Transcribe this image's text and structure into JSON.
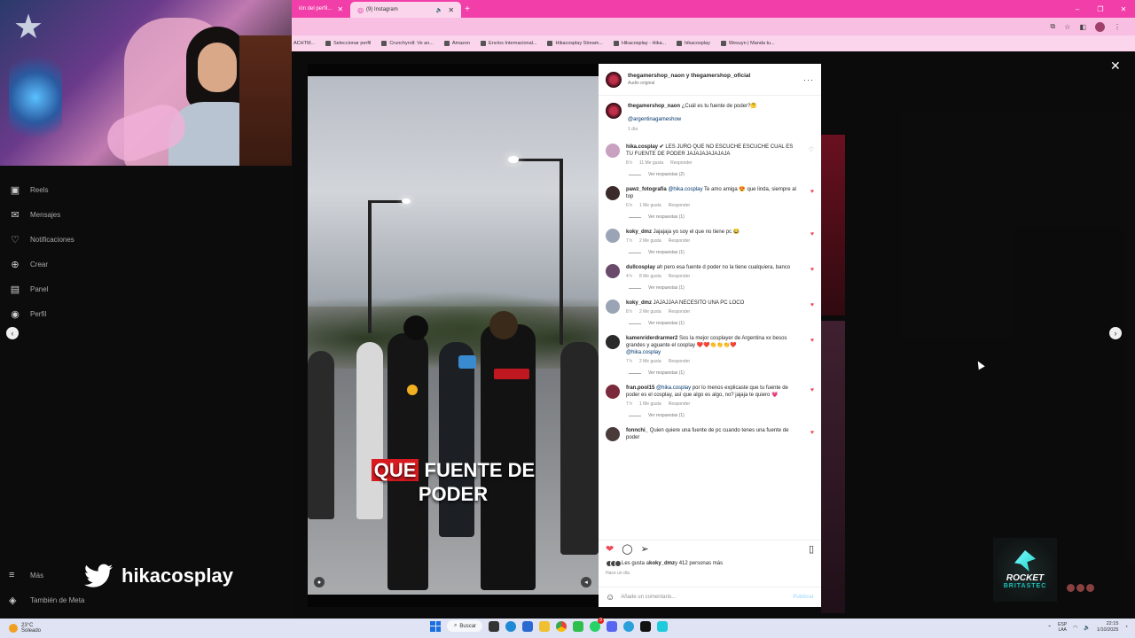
{
  "browser": {
    "tabs": [
      {
        "label": "ión del perfil... ",
        "active": false
      },
      {
        "label": "(9) Instagram",
        "active": true
      }
    ],
    "bookmarks": [
      "Seleccionar perfil",
      "Crunchyroll: Ve an...",
      "Amazon",
      "Envíos Internacional...",
      "Hikacosplay Stream...",
      "Hikacosplay - Hika...",
      "hikacosplay",
      "Wesuyn | Manda tu..."
    ],
    "left_clip_label": "ACHTM...",
    "win_controls": [
      "–",
      "❐",
      "✕"
    ]
  },
  "instagram_sidebar": {
    "items": [
      {
        "icon": "reels-icon",
        "glyph": "▣",
        "label": "Reels"
      },
      {
        "icon": "messages-icon",
        "glyph": "✉",
        "label": "Mensajes"
      },
      {
        "icon": "heart-icon",
        "glyph": "♡",
        "label": "Notificaciones"
      },
      {
        "icon": "create-icon",
        "glyph": "⊕",
        "label": "Crear"
      },
      {
        "icon": "panel-icon",
        "glyph": "▤",
        "label": "Panel"
      },
      {
        "icon": "profile-icon",
        "glyph": "◉",
        "label": "Perfil"
      }
    ],
    "bottom_items": [
      {
        "icon": "menu-icon",
        "glyph": "≡",
        "label": "Más"
      },
      {
        "icon": "meta-icon",
        "glyph": "◈",
        "label": "También de Meta"
      }
    ]
  },
  "overlay": {
    "twitter_handle": "hikacosplay"
  },
  "video": {
    "caption_highlight": "QUE",
    "caption_rest": " FUENTE DE",
    "caption_line2": "PODER"
  },
  "post": {
    "owner": "thegamershop_naon y thegamershop_oficial",
    "audio": "Audio original",
    "caption_user": "thegamershop_naon",
    "caption_text": " ¿Cuál es tu fuente de poder?🤔",
    "caption_mention": "@argentinagameshow",
    "caption_time": "1 día",
    "comments": [
      {
        "user": "hika.cosplay ✔",
        "mention": "",
        "text": " LES JURO QUE NO ESCUCHE ESCUCHE CUAL ES TU FUENTE DE PODER JAJAJAJAJAJAJA",
        "time": "8 h",
        "likes": "11 Me gusta",
        "reply": "Responder",
        "replies": "Ver respuestas (2)",
        "liked": false,
        "avatar": "#c8a0c0"
      },
      {
        "user": "pawz_fotografia",
        "mention": " @hika.cosplay",
        "text": " Te amo amiga 😍 que linda, siempre al top",
        "time": "6 h",
        "likes": "1 Me gusta",
        "reply": "Responder",
        "replies": "Ver respuestas (1)",
        "liked": true,
        "avatar": "#3a2a2a"
      },
      {
        "user": "koky_dmz",
        "mention": "",
        "text": " Jajajaja yo soy el que no tiene pc 😂",
        "time": "7 h",
        "likes": "2 Me gusta",
        "reply": "Responder",
        "replies": "Ver respuestas (1)",
        "liked": true,
        "avatar": "#9aa4b4"
      },
      {
        "user": "dullcosplay",
        "mention": "",
        "text": " ah pero esa fuente d poder no la tiene cualquiera, banco",
        "time": "4 h",
        "likes": "8 Me gusta",
        "reply": "Responder",
        "replies": "Ver respuestas (1)",
        "liked": true,
        "avatar": "#6a4a6a"
      },
      {
        "user": "koky_dmz",
        "mention": "",
        "text": " JAJAJJAA NECESITO UNA PC LOCO",
        "time": "8 h",
        "likes": "2 Me gusta",
        "reply": "Responder",
        "replies": "Ver respuestas (1)",
        "liked": true,
        "avatar": "#9aa4b4"
      },
      {
        "user": "kamenriderdrarmer2",
        "mention": "",
        "text": " Sos la mejor cosplayer de Argentina xx besos grandes y aguante el cosplay ❤️❤️👏👏👏❤️",
        "mention_after": "@hika.cosplay",
        "time": "7 h",
        "likes": "2 Me gusta",
        "reply": "Responder",
        "replies": "Ver respuestas (1)",
        "liked": true,
        "avatar": "#2a2a2a"
      },
      {
        "user": "fran.pool15",
        "mention": " @hika.cosplay",
        "text": " por lo menos explicaste que tu fuente de poder es el cosplay, así que algo es algo, no? jajaja te quiero 💗",
        "time": "7 h",
        "likes": "1 Me gusta",
        "reply": "Responder",
        "replies": "Ver respuestas (1)",
        "liked": true,
        "avatar": "#7a2a3a"
      },
      {
        "user": "fonnchi_",
        "mention": "",
        "text": " Quien quiere una fuente de pc cuando tenes una fuente de poder",
        "time": "",
        "likes": "",
        "reply": "",
        "replies": "",
        "liked": true,
        "avatar": "#4a3a3a"
      }
    ],
    "likes_by_user": "koky_dmz",
    "likes_prefix": "Les gusta a ",
    "likes_suffix": " y 412 personas más",
    "time_ago": "Hace un día",
    "comment_placeholder": "Añade un comentario...",
    "publish_label": "Publicar"
  },
  "stream_logo": {
    "title": "ROCKET",
    "subtitle": "BRITASTEC"
  },
  "taskbar": {
    "weather_temp": "23°C",
    "weather_desc": "Soleado",
    "search_label": "Buscar",
    "notif_badge": "9",
    "lang_top": "ESP",
    "lang_bottom": "LAA",
    "time": "22:15",
    "date": "1/10/2025"
  },
  "colors": {
    "tab_bar": "#f23ea9",
    "heart": "#ed4956",
    "mention": "#00376b",
    "caption_highlight": "#d91a20"
  }
}
